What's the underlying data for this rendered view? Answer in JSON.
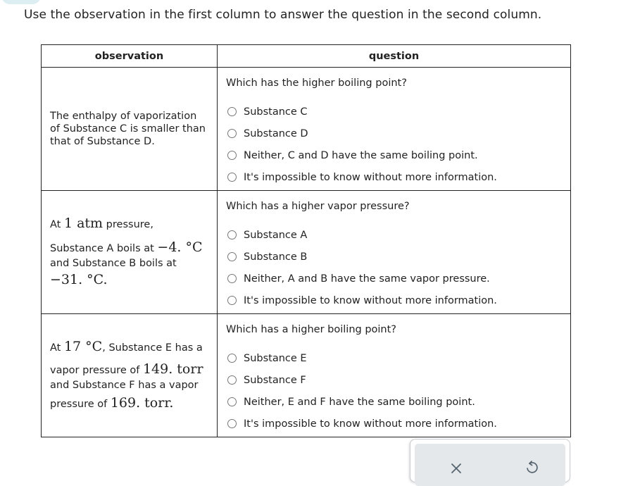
{
  "instructions": "Use the observation in the first column to answer the question in the second column.",
  "table": {
    "headers": {
      "observation": "observation",
      "question": "question"
    },
    "rows": [
      {
        "observation": {
          "text": "The enthalpy of vaporization of Substance C is smaller than that of Substance D."
        },
        "question": "Which has the higher boiling point?",
        "options": [
          "Substance C",
          "Substance D",
          "Neither, C and D have the same boiling point.",
          "It's impossible to know without more information."
        ]
      },
      {
        "observation": {
          "p1_pre": "At ",
          "p1_math": "1 atm",
          "p1_post": " pressure,",
          "p2_pre": "Substance A boils at ",
          "p2_math": "−4. °C",
          "p3_pre": "and Substance B boils at",
          "p3_math": "−31. °C."
        },
        "question": "Which has a higher vapor pressure?",
        "options": [
          "Substance A",
          "Substance B",
          "Neither, A and B have the same vapor pressure.",
          "It's impossible to know without more information."
        ]
      },
      {
        "observation": {
          "p1_pre": "At ",
          "p1_math": "17 °C",
          "p1_post": ", Substance E has a",
          "p2_pre": "vapor pressure of ",
          "p2_math": "149. torr",
          "p3_pre": "and Substance F has a vapor",
          "p4_pre": "pressure of ",
          "p4_math": "169. torr."
        },
        "question": "Which has a higher boiling point?",
        "options": [
          "Substance E",
          "Substance F",
          "Neither, E and F have the same boiling point.",
          "It's impossible to know without more information."
        ]
      }
    ]
  },
  "toolbar": {
    "clear_icon": "✕",
    "undo_icon": "undo-arrow"
  }
}
